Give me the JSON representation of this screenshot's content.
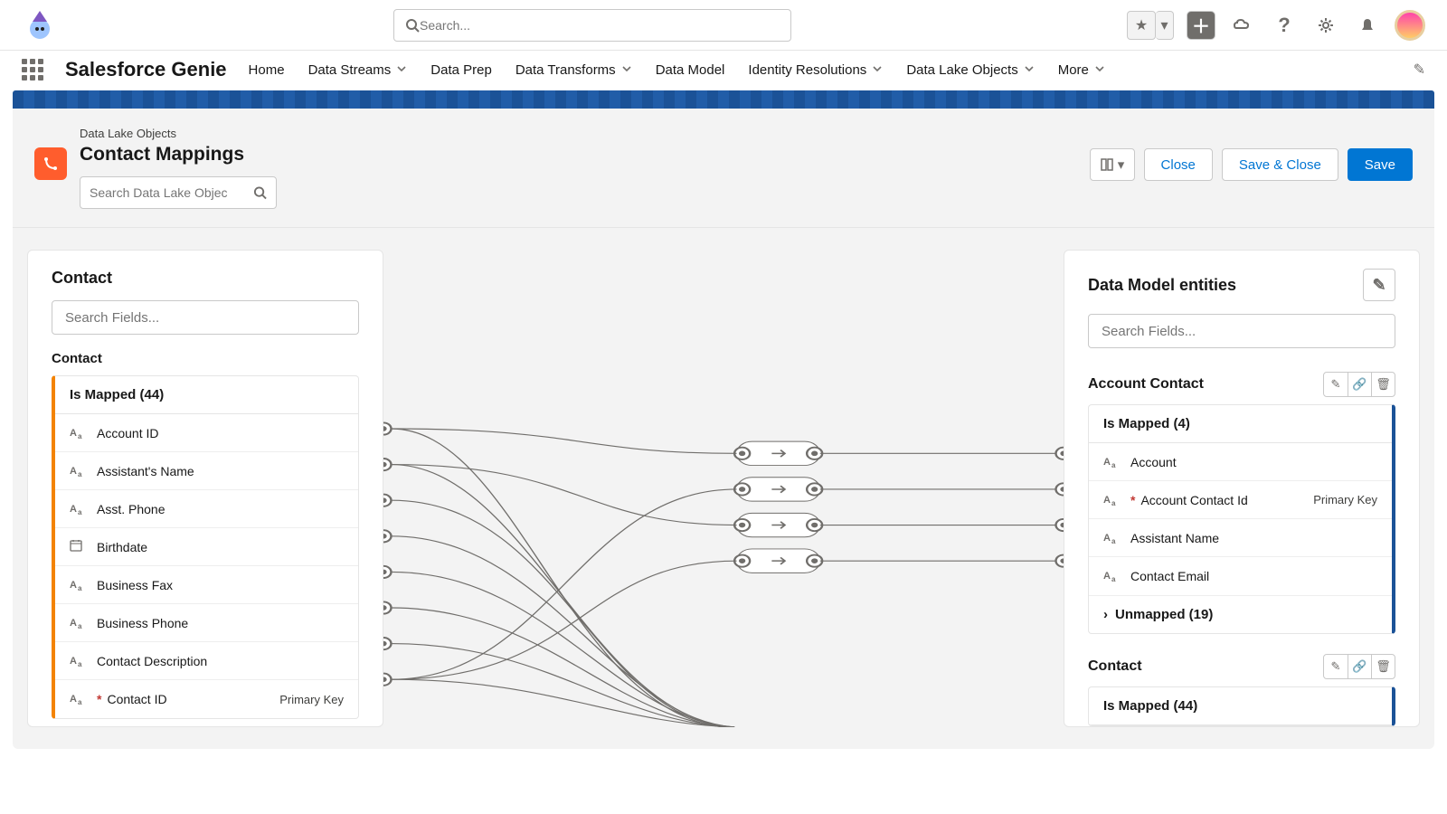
{
  "global": {
    "search_placeholder": "Search...",
    "app_name": "Salesforce Genie"
  },
  "nav_tabs": [
    {
      "label": "Home",
      "dropdown": false
    },
    {
      "label": "Data Streams",
      "dropdown": true
    },
    {
      "label": "Data Prep",
      "dropdown": false
    },
    {
      "label": "Data Transforms",
      "dropdown": true
    },
    {
      "label": "Data Model",
      "dropdown": false
    },
    {
      "label": "Identity Resolutions",
      "dropdown": true
    },
    {
      "label": "Data Lake Objects",
      "dropdown": true
    },
    {
      "label": "More",
      "dropdown": true
    }
  ],
  "page_header": {
    "breadcrumb": "Data Lake Objects",
    "title": "Contact Mappings",
    "dlo_search_placeholder": "Search Data Lake Objec",
    "close_label": "Close",
    "save_close_label": "Save & Close",
    "save_label": "Save"
  },
  "left_panel": {
    "title": "Contact",
    "search_placeholder": "Search Fields...",
    "subtitle": "Contact",
    "mapped_header": "Is Mapped (44)",
    "fields": [
      {
        "type": "Aa",
        "label": "Account ID",
        "required": false,
        "pk": false
      },
      {
        "type": "Aa",
        "label": "Assistant's Name",
        "required": false,
        "pk": false
      },
      {
        "type": "Aa",
        "label": "Asst. Phone",
        "required": false,
        "pk": false
      },
      {
        "type": "date",
        "label": "Birthdate",
        "required": false,
        "pk": false
      },
      {
        "type": "Aa",
        "label": "Business Fax",
        "required": false,
        "pk": false
      },
      {
        "type": "Aa",
        "label": "Business Phone",
        "required": false,
        "pk": false
      },
      {
        "type": "Aa",
        "label": "Contact Description",
        "required": false,
        "pk": false
      },
      {
        "type": "Aa",
        "label": "Contact ID",
        "required": true,
        "pk": true
      }
    ],
    "pk_label": "Primary Key"
  },
  "right_panel": {
    "title": "Data Model entities",
    "search_placeholder": "Search Fields...",
    "entities": [
      {
        "name": "Account Contact",
        "mapped_header": "Is Mapped (4)",
        "fields": [
          {
            "type": "Aa",
            "label": "Account",
            "required": false,
            "pk": false
          },
          {
            "type": "Aa",
            "label": "Account Contact Id",
            "required": true,
            "pk": true
          },
          {
            "type": "Aa",
            "label": "Assistant Name",
            "required": false,
            "pk": false
          },
          {
            "type": "Aa",
            "label": "Contact Email",
            "required": false,
            "pk": false
          }
        ],
        "unmapped_label": "Unmapped (19)"
      },
      {
        "name": "Contact",
        "mapped_header": "Is Mapped (44)"
      }
    ],
    "pk_label": "Primary Key"
  }
}
